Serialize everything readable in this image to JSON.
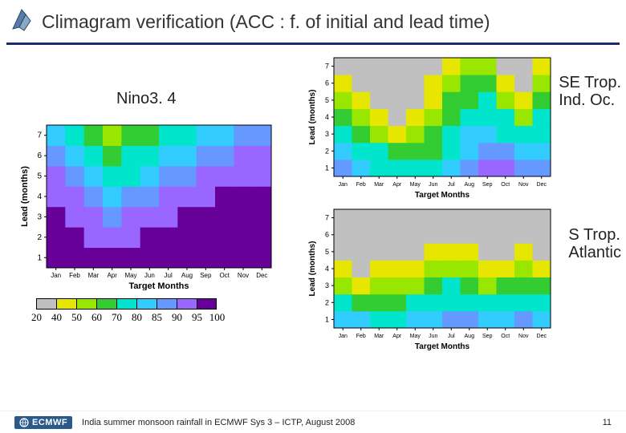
{
  "title": "Climagram verification (ACC : f. of initial and lead time)",
  "panels": {
    "nino": {
      "label": "Nino3. 4",
      "xlabel": "Target Months",
      "ylabel": "Lead (months)"
    },
    "se": {
      "label": "SE Trop.\nInd. Oc.",
      "xlabel": "Target Months",
      "ylabel": "Lead (months)"
    },
    "sa": {
      "label": "S Trop.\nAtlantic",
      "xlabel": "Target Months",
      "ylabel": "Lead (months)"
    }
  },
  "axis": {
    "months": [
      "Jan",
      "Feb",
      "Mar",
      "Apr",
      "May",
      "Jun",
      "Jul",
      "Aug",
      "Sep",
      "Oct",
      "Nov",
      "Dec"
    ],
    "leads": [
      1,
      2,
      3,
      4,
      5,
      6,
      7
    ]
  },
  "legend": {
    "breaks": [
      20,
      40,
      50,
      60,
      70,
      80,
      85,
      90,
      95,
      100
    ],
    "colors": [
      "#c0c0c0",
      "#e6e600",
      "#99e600",
      "#33cc33",
      "#00e5cc",
      "#33ccff",
      "#6699ff",
      "#9966ff",
      "#660099"
    ]
  },
  "footer": {
    "org": "ECMWF",
    "text": "India summer monsoon rainfall in ECMWF Sys 3 – ICTP, August 2008",
    "page": "11"
  },
  "chart_data": [
    {
      "id": "nino34",
      "type": "heatmap",
      "title": "Nino3.4",
      "xlabel": "Target Months",
      "ylabel": "Lead (months)",
      "x": [
        "Jan",
        "Feb",
        "Mar",
        "Apr",
        "May",
        "Jun",
        "Jul",
        "Aug",
        "Sep",
        "Oct",
        "Nov",
        "Dec"
      ],
      "y": [
        1,
        2,
        3,
        4,
        5,
        6,
        7
      ],
      "ylim": [
        1,
        7
      ],
      "color_scale_breaks": [
        20,
        40,
        50,
        60,
        70,
        80,
        85,
        90,
        95,
        100
      ],
      "values": [
        [
          97,
          97,
          95,
          95,
          95,
          97,
          97,
          97,
          97,
          97,
          97,
          97
        ],
        [
          97,
          95,
          92,
          92,
          92,
          95,
          95,
          97,
          97,
          97,
          97,
          97
        ],
        [
          95,
          92,
          90,
          87,
          90,
          92,
          92,
          95,
          95,
          97,
          97,
          97
        ],
        [
          92,
          90,
          87,
          82,
          85,
          87,
          90,
          92,
          92,
          95,
          95,
          95
        ],
        [
          90,
          87,
          82,
          75,
          78,
          82,
          85,
          87,
          90,
          92,
          92,
          92
        ],
        [
          87,
          82,
          75,
          65,
          70,
          75,
          80,
          82,
          85,
          87,
          90,
          90
        ],
        [
          82,
          75,
          65,
          55,
          60,
          65,
          72,
          78,
          80,
          82,
          85,
          87
        ]
      ]
    },
    {
      "id": "se_trop_ind_oc",
      "type": "heatmap",
      "title": "SE Trop. Ind. Oc.",
      "xlabel": "Target Months",
      "ylabel": "Lead (months)",
      "x": [
        "Jan",
        "Feb",
        "Mar",
        "Apr",
        "May",
        "Jun",
        "Jul",
        "Aug",
        "Sep",
        "Oct",
        "Nov",
        "Dec"
      ],
      "y": [
        1,
        2,
        3,
        4,
        5,
        6,
        7
      ],
      "ylim": [
        1,
        7
      ],
      "color_scale_breaks": [
        20,
        40,
        50,
        60,
        70,
        80,
        85,
        90,
        95,
        100
      ],
      "values": [
        [
          85,
          82,
          78,
          72,
          72,
          75,
          80,
          85,
          92,
          90,
          85,
          85
        ],
        [
          80,
          75,
          70,
          62,
          60,
          65,
          75,
          82,
          88,
          85,
          80,
          82
        ],
        [
          75,
          65,
          55,
          45,
          50,
          60,
          72,
          80,
          82,
          78,
          72,
          78
        ],
        [
          65,
          55,
          40,
          35,
          40,
          55,
          65,
          75,
          78,
          70,
          55,
          70
        ],
        [
          55,
          40,
          30,
          30,
          35,
          45,
          60,
          68,
          70,
          55,
          40,
          60
        ],
        [
          40,
          30,
          25,
          25,
          30,
          40,
          52,
          60,
          60,
          40,
          30,
          50
        ],
        [
          30,
          25,
          25,
          25,
          28,
          35,
          45,
          52,
          50,
          30,
          28,
          40
        ]
      ]
    },
    {
      "id": "s_trop_atlantic",
      "type": "heatmap",
      "title": "S Trop. Atlantic",
      "xlabel": "Target Months",
      "ylabel": "Lead (months)",
      "x": [
        "Jan",
        "Feb",
        "Mar",
        "Apr",
        "May",
        "Jun",
        "Jul",
        "Aug",
        "Sep",
        "Oct",
        "Nov",
        "Dec"
      ],
      "y": [
        1,
        2,
        3,
        4,
        5,
        6,
        7
      ],
      "ylim": [
        1,
        7
      ],
      "color_scale_breaks": [
        20,
        40,
        50,
        60,
        70,
        80,
        85,
        90,
        95,
        100
      ],
      "values": [
        [
          82,
          80,
          78,
          78,
          80,
          82,
          85,
          85,
          82,
          82,
          85,
          82
        ],
        [
          70,
          65,
          62,
          65,
          70,
          75,
          78,
          78,
          72,
          72,
          78,
          72
        ],
        [
          55,
          48,
          50,
          55,
          58,
          65,
          70,
          68,
          58,
          60,
          68,
          60
        ],
        [
          40,
          35,
          40,
          45,
          48,
          55,
          58,
          55,
          42,
          48,
          55,
          48
        ],
        [
          30,
          28,
          32,
          35,
          38,
          45,
          48,
          42,
          32,
          38,
          45,
          38
        ],
        [
          25,
          25,
          28,
          30,
          32,
          38,
          38,
          32,
          28,
          32,
          38,
          30
        ],
        [
          25,
          25,
          25,
          28,
          28,
          30,
          30,
          28,
          25,
          28,
          30,
          28
        ]
      ]
    }
  ]
}
